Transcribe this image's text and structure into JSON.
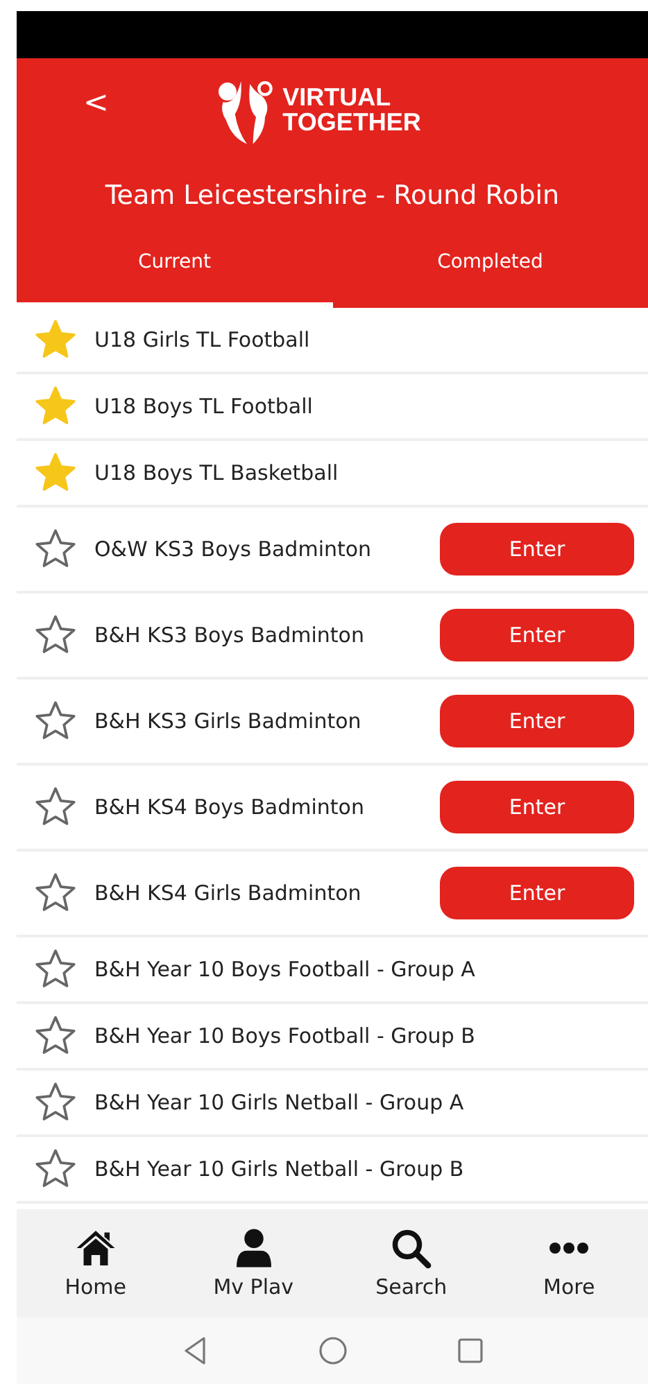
{
  "header": {
    "back": "<",
    "logo": [
      "VIRTUAL",
      "TOGETHER"
    ],
    "title": "Team Leicestershire - Round Robin"
  },
  "tabs": [
    {
      "label": "Current",
      "selected": true
    },
    {
      "label": "Completed",
      "selected": false
    }
  ],
  "events": [
    {
      "name": "U18 Girls TL Football",
      "favorite": true
    },
    {
      "name": "U18 Boys TL Football",
      "favorite": true
    },
    {
      "name": "U18 Boys TL Basketball",
      "favorite": true
    },
    {
      "name": "O&W KS3 Boys Badminton",
      "favorite": false,
      "action": "Enter"
    },
    {
      "name": "B&H KS3 Boys Badminton",
      "favorite": false,
      "action": "Enter"
    },
    {
      "name": "B&H KS3 Girls Badminton",
      "favorite": false,
      "action": "Enter"
    },
    {
      "name": "B&H KS4 Boys Badminton",
      "favorite": false,
      "action": "Enter"
    },
    {
      "name": "B&H KS4 Girls Badminton",
      "favorite": false,
      "action": "Enter"
    },
    {
      "name": "B&H Year 10 Boys Football - Group A",
      "favorite": false
    },
    {
      "name": "B&H Year 10 Boys Football - Group B",
      "favorite": false
    },
    {
      "name": "B&H Year 10 Girls Netball - Group A",
      "favorite": false
    },
    {
      "name": "B&H Year 10 Girls Netball - Group B",
      "favorite": false
    }
  ],
  "bottom_nav": [
    {
      "kind": "home",
      "label": "Home"
    },
    {
      "kind": "person",
      "label": "Mv Plav"
    },
    {
      "kind": "search",
      "label": "Search"
    },
    {
      "kind": "more",
      "label": "More"
    }
  ]
}
